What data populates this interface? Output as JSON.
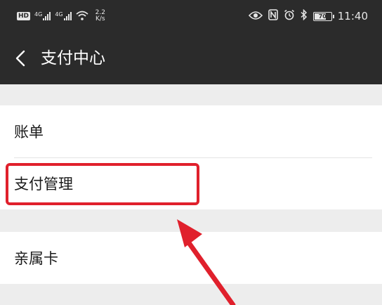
{
  "status_bar": {
    "hd_badge": "HD",
    "sim1_type": "4G",
    "sim2_type": "4G",
    "net_speed_value": "2.2",
    "net_speed_unit": "K/s",
    "battery_percent": "70",
    "time": "11:40",
    "icons": [
      "eye-icon",
      "nfc-icon",
      "alarm-icon",
      "bluetooth-icon",
      "battery-icon",
      "wifi-icon",
      "signal-icon"
    ]
  },
  "nav": {
    "title": "支付中心",
    "back_icon": "chevron-left-icon"
  },
  "groups": [
    {
      "items": [
        {
          "label": "账单"
        },
        {
          "label": "支付管理"
        }
      ]
    },
    {
      "items": [
        {
          "label": "亲属卡"
        }
      ]
    }
  ],
  "annotation": {
    "highlighted_item": "支付管理",
    "color": "#e0202c"
  },
  "colors": {
    "header_bg": "#2b2b2b",
    "page_bg": "#ededed",
    "card_bg": "#ffffff",
    "accent_red": "#e0202c"
  }
}
